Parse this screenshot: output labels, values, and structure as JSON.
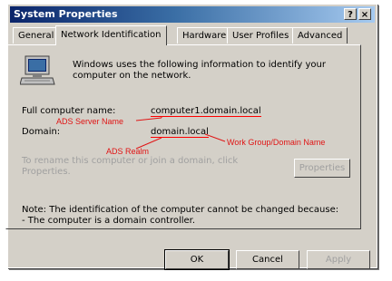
{
  "window": {
    "title": "System Properties",
    "help_glyph": "?",
    "close_glyph": "×"
  },
  "tabs": [
    {
      "label": "General",
      "active": false
    },
    {
      "label": "Network Identification",
      "active": true
    },
    {
      "label": "Hardware",
      "active": false
    },
    {
      "label": "User Profiles",
      "active": false
    },
    {
      "label": "Advanced",
      "active": false
    }
  ],
  "panel": {
    "intro": "Windows uses the following information to identify your computer on the network.",
    "full_name_label": "Full computer name:",
    "full_name_value": "computer1.domain.local",
    "domain_label": "Domain:",
    "domain_value": "domain.local",
    "rename_text": "To rename this computer or join a domain, click Properties.",
    "properties_button": "Properties",
    "note_line1": "Note: The identification of the computer cannot be changed because:",
    "note_line2": "- The computer is a domain controller."
  },
  "annotations": {
    "ads_server_name": "ADS Server Name",
    "ads_realm": "ADS Realm",
    "workgroup_domain_name": "Work Group/Domain Name",
    "color": "#e01515"
  },
  "footer": {
    "ok": "OK",
    "cancel": "Cancel",
    "apply": "Apply"
  },
  "colors": {
    "dialog_bg": "#d4d0c8",
    "titlebar_start": "#0a246a",
    "titlebar_end": "#a6caf0"
  }
}
